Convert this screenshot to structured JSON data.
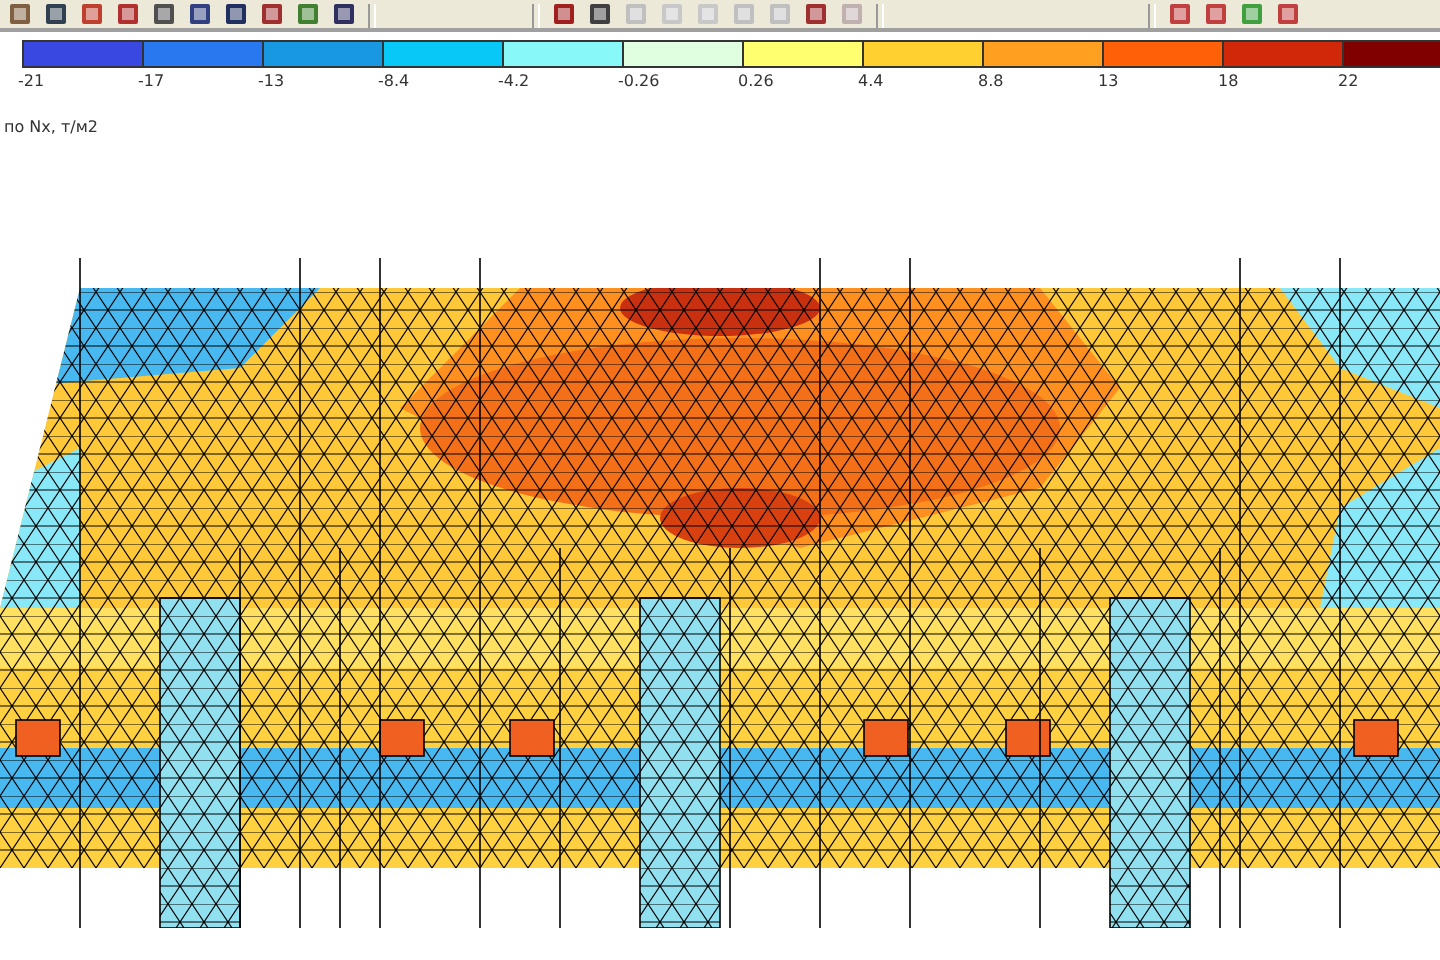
{
  "legend": {
    "bins": [
      {
        "label": "-21",
        "color": "#3848e0"
      },
      {
        "label": "-17",
        "color": "#2a78f0"
      },
      {
        "label": "-13",
        "color": "#1898e0"
      },
      {
        "label": "-8.4",
        "color": "#08c8f8"
      },
      {
        "label": "-4.2",
        "color": "#88f8f8"
      },
      {
        "label": "-0.26",
        "color": "#e0ffe0"
      },
      {
        "label": "0.26",
        "color": "#ffff70"
      },
      {
        "label": "4.4",
        "color": "#ffd030"
      },
      {
        "label": "8.8",
        "color": "#ffa020"
      },
      {
        "label": "13",
        "color": "#ff6008"
      },
      {
        "label": "18",
        "color": "#d02808"
      },
      {
        "label": "22",
        "color": "#800000"
      }
    ]
  },
  "caption": "по Nx, т/м2"
}
